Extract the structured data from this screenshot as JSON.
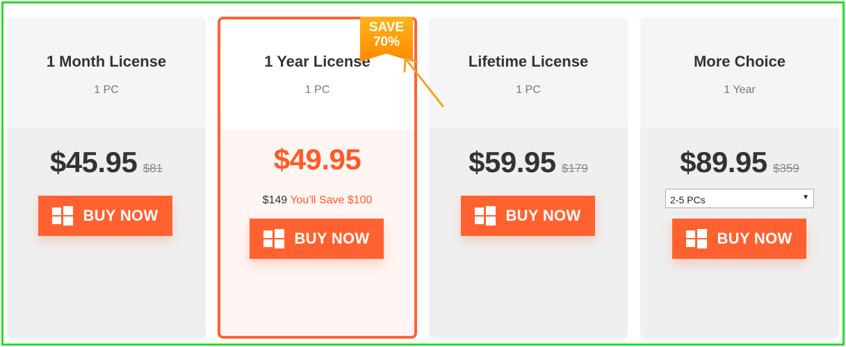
{
  "plans": [
    {
      "title": "1 Month License",
      "subtitle": "1 PC",
      "price": "$45.95",
      "old_price": "$81",
      "button": "BUY NOW"
    },
    {
      "title": "1 Year License",
      "subtitle": "1 PC",
      "price": "$49.95",
      "save_original": "$149",
      "save_text": "You'll Save $100",
      "button": "BUY NOW",
      "badge": "SAVE\n70%"
    },
    {
      "title": "Lifetime License",
      "subtitle": "1 PC",
      "price": "$59.95",
      "old_price": "$179",
      "button": "BUY NOW"
    },
    {
      "title": "More Choice",
      "subtitle": "1 Year",
      "price": "$89.95",
      "old_price": "$359",
      "selected_option": "2-5 PCs",
      "button": "BUY NOW"
    }
  ],
  "colors": {
    "accent": "#ff6230",
    "featured_border": "#ff6234",
    "badge": "#ff9a00",
    "frame": "#22e022",
    "annotation_arrow": "#f7a21b"
  },
  "icons": {
    "button_icon": "windows-logo-icon",
    "annotation": "arrow-annotation-icon"
  }
}
